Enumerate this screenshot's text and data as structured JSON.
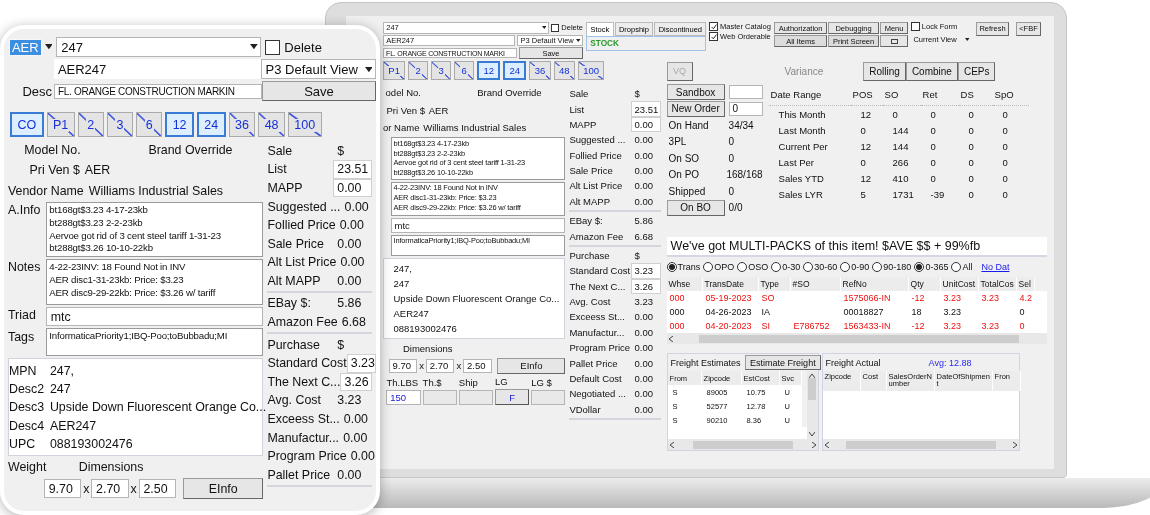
{
  "zoom_panel": {
    "prefix": "AER",
    "item": "247",
    "delete": {
      "label": "Delete",
      "checked": false
    },
    "code": "AER247",
    "desc": {
      "label": "Desc",
      "value": "FL. ORANGE CONSTRUCTION MARKIN"
    },
    "view": "P3 Default View",
    "save": "Save",
    "packs": [
      {
        "label": "CO",
        "selected": true,
        "struck": false
      },
      {
        "label": "P1",
        "selected": false,
        "struck": true
      },
      {
        "label": "2",
        "selected": false,
        "struck": true
      },
      {
        "label": "3",
        "selected": false,
        "struck": true
      },
      {
        "label": "6",
        "selected": false,
        "struck": true
      },
      {
        "label": "12",
        "selected": true,
        "struck": false
      },
      {
        "label": "24",
        "selected": true,
        "struck": false
      },
      {
        "label": "36",
        "selected": false,
        "struck": true
      },
      {
        "label": "48",
        "selected": false,
        "struck": true
      },
      {
        "label": "100",
        "selected": false,
        "struck": true
      }
    ],
    "model_label": "Model No.",
    "brand_label": "Brand Override",
    "pri_ven": {
      "label": "Pri Ven $",
      "value": "AER"
    },
    "vendor": {
      "label": "Vendor Name",
      "value": "Williams Industrial Sales"
    },
    "info": {
      "label": "A.Info",
      "lines": [
        "bt168gt$3.23 4-17-23kb",
        "bt288gt$3.23 2-2-23kb",
        "Aervoe got rid of 3 cent steel tariff 1-31-23",
        "bt288gt$3.26 10-10-22kb"
      ]
    },
    "notes": {
      "label": "Notes",
      "lines": [
        "4-22-23INV: 18 Found Not in INV",
        "AER disc1-31-23kb: Price: $3.23",
        "AER disc9-29-22kb: Price: $3.26 w/ tariff"
      ]
    },
    "triad": {
      "label": "Triad",
      "value": "mtc"
    },
    "tags": {
      "label": "Tags",
      "value": "InformaticaPriority1;IBQ-Poo;toBubbadu;MI"
    },
    "ids": [
      {
        "label": "MPN",
        "value": "247,"
      },
      {
        "label": "Desc2",
        "value": "247"
      },
      {
        "label": "Desc3",
        "value": "Upside Down Fluorescent Orange Co..."
      },
      {
        "label": "Desc4",
        "value": "AER247"
      },
      {
        "label": "UPC",
        "value": "088193002476"
      }
    ],
    "weight_label": "Weight",
    "dimensions_label": "Dimensions",
    "dims": [
      {
        "value": "9.70"
      },
      {
        "sep": "x",
        "value": "2.70"
      },
      {
        "sep": "x",
        "value": "2.50"
      }
    ],
    "einfo": "EInfo",
    "sale": {
      "title": "Sale",
      "currency": "$",
      "rows": [
        {
          "label": "List",
          "value": "23.51",
          "editable": true
        },
        {
          "label": "MAPP",
          "value": "0.00",
          "editable": true
        },
        {
          "label": "Suggested ...",
          "value": "0.00",
          "editable": false
        },
        {
          "label": "Follied Price",
          "value": "0.00",
          "editable": false
        },
        {
          "label": "Sale Price",
          "value": "0.00",
          "editable": false
        },
        {
          "label": "Alt List Price",
          "value": "0.00",
          "editable": false
        },
        {
          "label": "Alt MAPP",
          "value": "0.00",
          "editable": false
        }
      ]
    },
    "fees": [
      {
        "label": "EBay $:",
        "value": "5.86"
      },
      {
        "label": "Amazon Fee",
        "value": "6.68"
      }
    ],
    "purchase": {
      "title": "Purchase",
      "currency": "$",
      "rows": [
        {
          "label": "Standard Cost",
          "value": "3.23",
          "editable": true
        },
        {
          "label": "The Next C...",
          "value": "3.26",
          "editable": true
        },
        {
          "label": "Avg. Cost",
          "value": "3.23",
          "editable": false
        },
        {
          "label": "Exceess St...",
          "value": "0.00",
          "editable": false
        },
        {
          "label": "Manufactur...",
          "value": "0.00",
          "editable": false
        },
        {
          "label": "Program Price",
          "value": "0.00",
          "editable": false
        },
        {
          "label": "Pallet Price",
          "value": "0.00",
          "editable": false
        }
      ]
    }
  },
  "screen": {
    "item": "247",
    "delete": {
      "label": "Delete",
      "checked": false
    },
    "code": "AER247",
    "desc": {
      "value": "FL. ORANGE CONSTRUCTION MARKI"
    },
    "view": "P3 Default View",
    "save": "Save",
    "tabs": [
      {
        "label": "Stock",
        "selected": true
      },
      {
        "label": "Dropship",
        "selected": false
      },
      {
        "label": "Discontinued",
        "selected": false
      }
    ],
    "status": "STOCK",
    "flags": [
      {
        "label": "Master Catalog",
        "checked": true
      },
      {
        "label": "Web Orderable",
        "checked": true
      }
    ],
    "tools": [
      "Authorization",
      "Debugging",
      "Menu",
      "All Items",
      "Print Screen"
    ],
    "lock": {
      "label": "Lock Form",
      "checked": false
    },
    "current_view": "Current View",
    "refresh": "Refresh",
    "fbf": "<FBF",
    "packs": [
      {
        "label": "P1",
        "selected": false,
        "struck": true
      },
      {
        "label": "2",
        "selected": false,
        "struck": true
      },
      {
        "label": "3",
        "selected": false,
        "struck": true
      },
      {
        "label": "6",
        "selected": false,
        "struck": true
      },
      {
        "label": "12",
        "selected": true,
        "struck": false
      },
      {
        "label": "24",
        "selected": true,
        "struck": false
      },
      {
        "label": "36",
        "selected": false,
        "struck": true
      },
      {
        "label": "48",
        "selected": false,
        "struck": true
      },
      {
        "label": "100",
        "selected": false,
        "struck": true
      }
    ],
    "model_label": "odel No.",
    "brand_label": "Brand Override",
    "pri_ven": {
      "label": "Pri Ven $",
      "value": "AER"
    },
    "vendor": {
      "label": "or Name",
      "value": "Williams Industrial Sales"
    },
    "info": {
      "lines": [
        "bt168gt$3.23 4-17-23kb",
        "bt288gt$3.23 2-2-23kb",
        "Aervoe got rid of 3 cent steel tariff 1-31-23",
        "bt288gt$3.26 10-10-22kb"
      ]
    },
    "notes": {
      "lines": [
        "4-22-23INV: 18 Found Not in INV",
        "AER disc1-31-23kb: Price: $3.23",
        "AER disc9-29-22kb: Price: $3.26 w/ tariff"
      ]
    },
    "triad": {
      "value": "mtc"
    },
    "tags": {
      "value": "InformaticaPriority1;IBQ-Poo;toBubbadu;MI"
    },
    "ids": [
      {
        "value": "247,"
      },
      {
        "value": "247"
      },
      {
        "value": "Upside Down Fluorescent Orange Co..."
      },
      {
        "value": "AER247"
      },
      {
        "value": "088193002476"
      }
    ],
    "dimensions_label": "Dimensions",
    "dims": [
      {
        "value": "9.70"
      },
      {
        "sep": "x",
        "value": "2.70"
      },
      {
        "sep": "x",
        "value": "2.50"
      }
    ],
    "einfo": "EInfo",
    "thresholds": [
      {
        "label": "Th.LBS",
        "kind": "field",
        "value": "150"
      },
      {
        "label": "Th.$",
        "kind": "field"
      },
      {
        "label": "Ship",
        "kind": "field"
      },
      {
        "label": "LG",
        "kind": "button",
        "value": "F"
      },
      {
        "label": "LG $",
        "kind": "field"
      }
    ],
    "sale": {
      "title": "Sale",
      "currency": "$",
      "rows": [
        {
          "label": "List",
          "value": "23.51",
          "editable": true
        },
        {
          "label": "MAPP",
          "value": "0.00",
          "editable": true
        },
        {
          "label": "Suggested ...",
          "value": "0.00",
          "editable": false
        },
        {
          "label": "Follied Price",
          "value": "0.00",
          "editable": false
        },
        {
          "label": "Sale Price",
          "value": "0.00",
          "editable": false
        },
        {
          "label": "Alt List Price",
          "value": "0.00",
          "editable": false
        },
        {
          "label": "Alt MAPP",
          "value": "0.00",
          "editable": false
        }
      ]
    },
    "fees": [
      {
        "label": "EBay $:",
        "value": "5.86"
      },
      {
        "label": "Amazon Fee",
        "value": "6.68"
      }
    ],
    "purchase": {
      "title": "Purchase",
      "currency": "$",
      "rows": [
        {
          "label": "Standard Cost",
          "value": "3.23",
          "editable": true
        },
        {
          "label": "The Next C...",
          "value": "3.26",
          "editable": true
        },
        {
          "label": "Avg. Cost",
          "value": "3.23",
          "editable": false
        },
        {
          "label": "Exceess St...",
          "value": "0.00",
          "editable": false
        },
        {
          "label": "Manufactur...",
          "value": "0.00",
          "editable": false
        },
        {
          "label": "Program Price",
          "value": "0.00",
          "editable": false
        },
        {
          "label": "Pallet Price",
          "value": "0.00",
          "editable": false
        },
        {
          "label": "Default Cost",
          "value": "0.00",
          "editable": false
        },
        {
          "label": "Negotiated ...",
          "value": "0.00",
          "editable": false
        },
        {
          "label": "VDollar",
          "value": "0.00",
          "editable": false
        }
      ]
    },
    "right": {
      "vq": {
        "label": "VQ",
        "disabled": true
      },
      "variance": "Variance",
      "views": [
        "Rolling",
        "Combine",
        "CEPs"
      ],
      "inventory": [
        {
          "kind": "action",
          "label": "Sandbox"
        },
        {
          "kind": "action",
          "label": "New Order",
          "value": "0"
        },
        {
          "kind": "stat",
          "label": "On Hand",
          "value": "34/34"
        },
        {
          "kind": "stat",
          "label": "3PL",
          "value": "0"
        },
        {
          "kind": "stat",
          "label": "On SO",
          "value": "0"
        },
        {
          "kind": "stat",
          "label": "On PO",
          "value": "168/168"
        },
        {
          "kind": "stat",
          "label": "Shipped",
          "value": "0"
        },
        {
          "kind": "action_text",
          "label": "On BO",
          "value": "0/0"
        }
      ],
      "stats": {
        "columns": [
          "Date Range",
          "POS",
          "SO",
          "Ret",
          "DS",
          "SpO"
        ],
        "rows": [
          [
            "This Month",
            "12",
            "0",
            "0",
            "0",
            "0"
          ],
          [
            "Last Month",
            "0",
            "144",
            "0",
            "0",
            "0"
          ],
          [
            "Current Per",
            "12",
            "144",
            "0",
            "0",
            "0"
          ],
          [
            "Last Per",
            "0",
            "266",
            "0",
            "0",
            "0"
          ],
          [
            "Sales YTD",
            "12",
            "410",
            "0",
            "0",
            "0"
          ],
          [
            "Sales LYR",
            "5",
            "1731",
            "-39",
            "0",
            "0"
          ]
        ]
      },
      "banner": "We've got MULTI-PACKS of this item! $AVE $$ + 99%fb",
      "filters": [
        {
          "label": "Trans",
          "selected": true
        },
        {
          "label": "OPO",
          "selected": false
        },
        {
          "label": "OSO",
          "selected": false
        },
        {
          "label": "0-30",
          "selected": false
        },
        {
          "label": "30-60",
          "selected": false
        },
        {
          "label": "0-90",
          "selected": false
        },
        {
          "label": "90-180",
          "selected": false
        },
        {
          "label": "0-365",
          "selected": true
        },
        {
          "label": "All",
          "selected": false
        }
      ],
      "no_date": "No Dat",
      "transactions": {
        "columns": [
          "Whse",
          "TransDate",
          "Type",
          "#SO",
          "RefNo",
          "Qty",
          "UnitCost",
          "TotalCos",
          "Sel"
        ],
        "rows": [
          {
            "alert": true,
            "cells": [
              "000",
              "05-19-2023",
              "SO",
              "",
              "1575066-IN",
              "-12",
              "3.23",
              "3.23",
              "4.2"
            ]
          },
          {
            "alert": false,
            "cells": [
              "000",
              "04-26-2023",
              "IA",
              "",
              "00018827",
              "18",
              "3.23",
              "",
              "0"
            ]
          },
          {
            "alert": true,
            "cells": [
              "000",
              "04-20-2023",
              "SI",
              "E786752",
              "1563433-IN",
              "-12",
              "3.23",
              "3.23",
              "0"
            ]
          }
        ]
      },
      "freight_estimates": {
        "title": "Freight Estimates",
        "button": "Estimate Freight",
        "columns": [
          "From",
          "Zipcode",
          "EstCost",
          "Svc"
        ],
        "rows": [
          [
            "S",
            "89005",
            "10.75",
            "U"
          ],
          [
            "S",
            "52577",
            "12.78",
            "U"
          ],
          [
            "S",
            "90210",
            "8.36",
            "U"
          ]
        ]
      },
      "freight_actual": {
        "title": "Freight Actual",
        "average": "Avg: 12.88",
        "columns": [
          "Zipcode",
          "Cost",
          "SalesOrderNumber",
          "DateOfShipment",
          "Fron"
        ]
      }
    }
  }
}
